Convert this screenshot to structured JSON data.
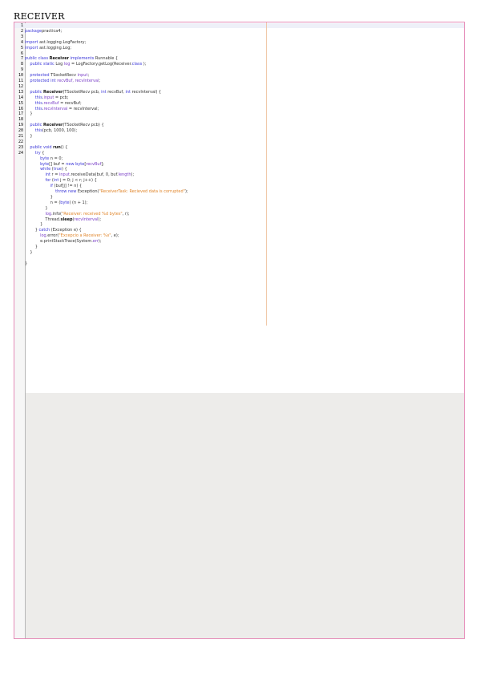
{
  "document": {
    "title": "RECEIVER"
  },
  "code_lines": [
    {
      "ln": "1",
      "seg": []
    },
    {
      "ln": "2",
      "seg": [
        [
          "kw",
          "package"
        ],
        [
          "",
          "practica4;"
        ]
      ]
    },
    {
      "ln": "3",
      "seg": []
    },
    {
      "ln": "4",
      "seg": [
        [
          "kw",
          "import"
        ],
        [
          "",
          " ast.logging.LogFactory;"
        ]
      ]
    },
    {
      "ln": "5",
      "seg": [
        [
          "kw",
          "import"
        ],
        [
          "",
          " ast.logging.Log;"
        ]
      ]
    },
    {
      "ln": "6",
      "seg": []
    },
    {
      "ln": "7",
      "seg": [
        [
          "kw",
          "public class "
        ],
        [
          "bold",
          "Receiver"
        ],
        [
          "kw",
          " implements"
        ],
        [
          "",
          " Runnable {"
        ]
      ]
    },
    {
      "ln": "8",
      "seg": [
        [
          "",
          "    "
        ],
        [
          "kw",
          "public static"
        ],
        [
          "",
          " Log "
        ],
        [
          "fld",
          "log"
        ],
        [
          "",
          " = LogFactory.getLog(Receiver."
        ],
        [
          "kw",
          "class"
        ],
        [
          "",
          " );"
        ]
      ]
    },
    {
      "ln": "9",
      "seg": []
    },
    {
      "ln": "10",
      "seg": [
        [
          "",
          "    "
        ],
        [
          "kw",
          "protected"
        ],
        [
          "",
          " TSocketRecv "
        ],
        [
          "fld",
          "input"
        ],
        [
          "",
          ";"
        ]
      ]
    },
    {
      "ln": "11",
      "seg": [
        [
          "",
          "    "
        ],
        [
          "kw",
          "protected int"
        ],
        [
          "fld",
          " recvBuf, recvInterval"
        ],
        [
          "",
          ";"
        ]
      ]
    },
    {
      "ln": "12",
      "seg": []
    },
    {
      "ln": "13",
      "seg": [
        [
          "",
          "    "
        ],
        [
          "kw",
          "public "
        ],
        [
          "bold",
          "Receiver"
        ],
        [
          "",
          "(TSocketRecv pcb, "
        ],
        [
          "kw",
          "int"
        ],
        [
          "",
          " recvBuf, "
        ],
        [
          "kw",
          "int"
        ],
        [
          "",
          " recvInterval) {"
        ]
      ]
    },
    {
      "ln": "14",
      "seg": [
        [
          "",
          "        "
        ],
        [
          "kw",
          "this"
        ],
        [
          "",
          "."
        ],
        [
          "fld",
          "input"
        ],
        [
          "",
          " = pcb;"
        ]
      ]
    },
    {
      "ln": "15",
      "seg": [
        [
          "",
          "        "
        ],
        [
          "kw",
          "this"
        ],
        [
          "",
          "."
        ],
        [
          "fld",
          "recvBuf"
        ],
        [
          "",
          " = recvBuf;"
        ]
      ]
    },
    {
      "ln": "16",
      "seg": [
        [
          "",
          "        "
        ],
        [
          "kw",
          "this"
        ],
        [
          "",
          "."
        ],
        [
          "fld",
          "recvInterval"
        ],
        [
          "",
          " = recvInterval;"
        ]
      ]
    },
    {
      "ln": "17",
      "seg": [
        [
          "",
          "    }"
        ]
      ]
    },
    {
      "ln": "18",
      "seg": []
    },
    {
      "ln": "19",
      "seg": [
        [
          "",
          "    "
        ],
        [
          "kw",
          "public "
        ],
        [
          "bold",
          "Receiver"
        ],
        [
          "",
          "(TSocketRecv pcb) {"
        ]
      ]
    },
    {
      "ln": "20",
      "seg": [
        [
          "",
          "        "
        ],
        [
          "kw",
          "this"
        ],
        [
          "",
          "(pcb, 1000, 100);"
        ]
      ]
    },
    {
      "ln": "21",
      "seg": [
        [
          "",
          "    }"
        ]
      ]
    },
    {
      "ln": "22",
      "seg": []
    },
    {
      "ln": "23",
      "seg": [
        [
          "",
          "    "
        ],
        [
          "kw",
          "public void "
        ],
        [
          "bold",
          "run"
        ],
        [
          "",
          "() {"
        ]
      ]
    },
    {
      "ln": "24",
      "seg": [
        [
          "",
          "        "
        ],
        [
          "kw",
          "try"
        ],
        [
          "",
          " {"
        ]
      ]
    },
    {
      "ln": "",
      "seg": [
        [
          "",
          "            "
        ],
        [
          "kw",
          "byte"
        ],
        [
          "",
          " n = 0;"
        ]
      ]
    },
    {
      "ln": "",
      "seg": [
        [
          "",
          "            "
        ],
        [
          "kw",
          "byte"
        ],
        [
          "",
          "[] buf = "
        ],
        [
          "kw",
          "new byte"
        ],
        [
          "",
          "["
        ],
        [
          "fld",
          "recvBuf"
        ],
        [
          "",
          "];"
        ]
      ]
    },
    {
      "ln": "",
      "seg": [
        [
          "",
          "            "
        ],
        [
          "kw",
          "while"
        ],
        [
          "",
          " ("
        ],
        [
          "kw",
          "true"
        ],
        [
          "",
          ") {"
        ]
      ]
    },
    {
      "ln": "",
      "seg": [
        [
          "",
          "                "
        ],
        [
          "kw",
          "int"
        ],
        [
          "",
          " r = "
        ],
        [
          "fld",
          "input"
        ],
        [
          "",
          ".receiveData(buf, 0, buf."
        ],
        [
          "fld",
          "length"
        ],
        [
          "",
          ");"
        ]
      ]
    },
    {
      "ln": "",
      "seg": [
        [
          "",
          "                "
        ],
        [
          "kw",
          "for"
        ],
        [
          "",
          " ("
        ],
        [
          "kw",
          "int"
        ],
        [
          "",
          " j = 0; j < r; j++) {"
        ]
      ]
    },
    {
      "ln": "",
      "seg": [
        [
          "",
          "                    "
        ],
        [
          "kw",
          "if"
        ],
        [
          "",
          " (buf[j] != n) {"
        ]
      ]
    },
    {
      "ln": "",
      "seg": [
        [
          "",
          "                        "
        ],
        [
          "kw",
          "throw new"
        ],
        [
          "",
          " Exception("
        ],
        [
          "str",
          "\"ReceiverTask: Recieved data is corrupted\""
        ],
        [
          "",
          ");"
        ]
      ]
    },
    {
      "ln": "",
      "seg": [
        [
          "",
          "                    }"
        ]
      ]
    },
    {
      "ln": "",
      "seg": [
        [
          "",
          "                    n = ("
        ],
        [
          "kw",
          "byte"
        ],
        [
          "",
          ") (n + 1);"
        ]
      ]
    },
    {
      "ln": "",
      "seg": [
        [
          "",
          "                }"
        ]
      ]
    },
    {
      "ln": "",
      "seg": [
        [
          "",
          "                "
        ],
        [
          "fld",
          "log"
        ],
        [
          "",
          ".info("
        ],
        [
          "str",
          "\"Receiver: received %d bytes\""
        ],
        [
          "",
          ", r);"
        ]
      ]
    },
    {
      "ln": "",
      "seg": [
        [
          "",
          "                Thread."
        ],
        [
          "bold",
          "sleep"
        ],
        [
          "",
          "("
        ],
        [
          "fld",
          "recvInterval"
        ],
        [
          "",
          ");"
        ]
      ]
    },
    {
      "ln": "",
      "seg": [
        [
          "",
          "            }"
        ]
      ]
    },
    {
      "ln": "",
      "seg": [
        [
          "",
          "        } "
        ],
        [
          "kw",
          "catch"
        ],
        [
          "",
          " (Exception e) {"
        ]
      ]
    },
    {
      "ln": "",
      "seg": [
        [
          "",
          "            "
        ],
        [
          "fld",
          "log"
        ],
        [
          "",
          ".error("
        ],
        [
          "str",
          "\"Excepcio a Receiver: %s\""
        ],
        [
          "",
          ", e);"
        ]
      ]
    },
    {
      "ln": "",
      "seg": [
        [
          "",
          "            e.printStackTrace(System."
        ],
        [
          "fld",
          "err"
        ],
        [
          "",
          ");"
        ]
      ]
    },
    {
      "ln": "",
      "seg": [
        [
          "",
          "        }"
        ]
      ]
    },
    {
      "ln": "",
      "seg": [
        [
          "",
          "    }"
        ]
      ]
    },
    {
      "ln": "",
      "seg": []
    },
    {
      "ln": "",
      "seg": [
        [
          "",
          "}"
        ]
      ]
    }
  ],
  "colors": {
    "frame_border": "#e58bb8",
    "keyword": "#3b37d8",
    "field": "#7a3fc7",
    "string": "#e0852a",
    "empty_area": "#edecea"
  }
}
